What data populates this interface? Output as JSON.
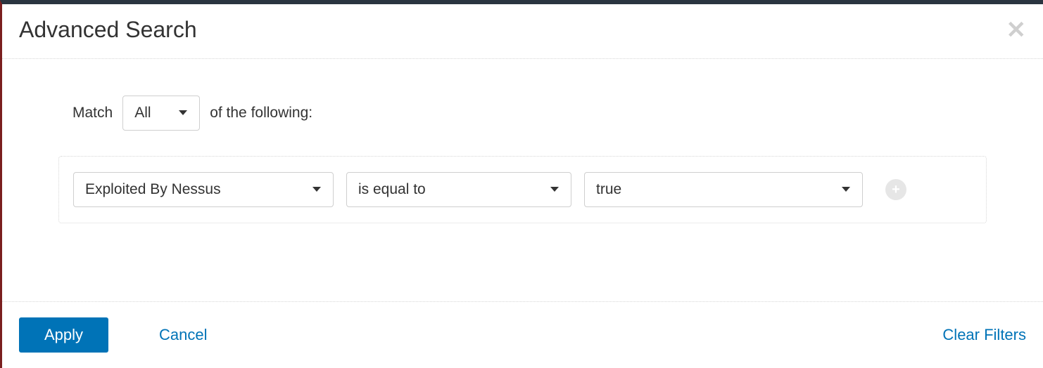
{
  "header": {
    "title": "Advanced Search"
  },
  "match": {
    "label": "Match",
    "value": "All",
    "suffix": "of the following:"
  },
  "filter": {
    "field": "Exploited By Nessus",
    "operator": "is equal to",
    "value": "true"
  },
  "footer": {
    "apply": "Apply",
    "cancel": "Cancel",
    "clear": "Clear Filters"
  }
}
